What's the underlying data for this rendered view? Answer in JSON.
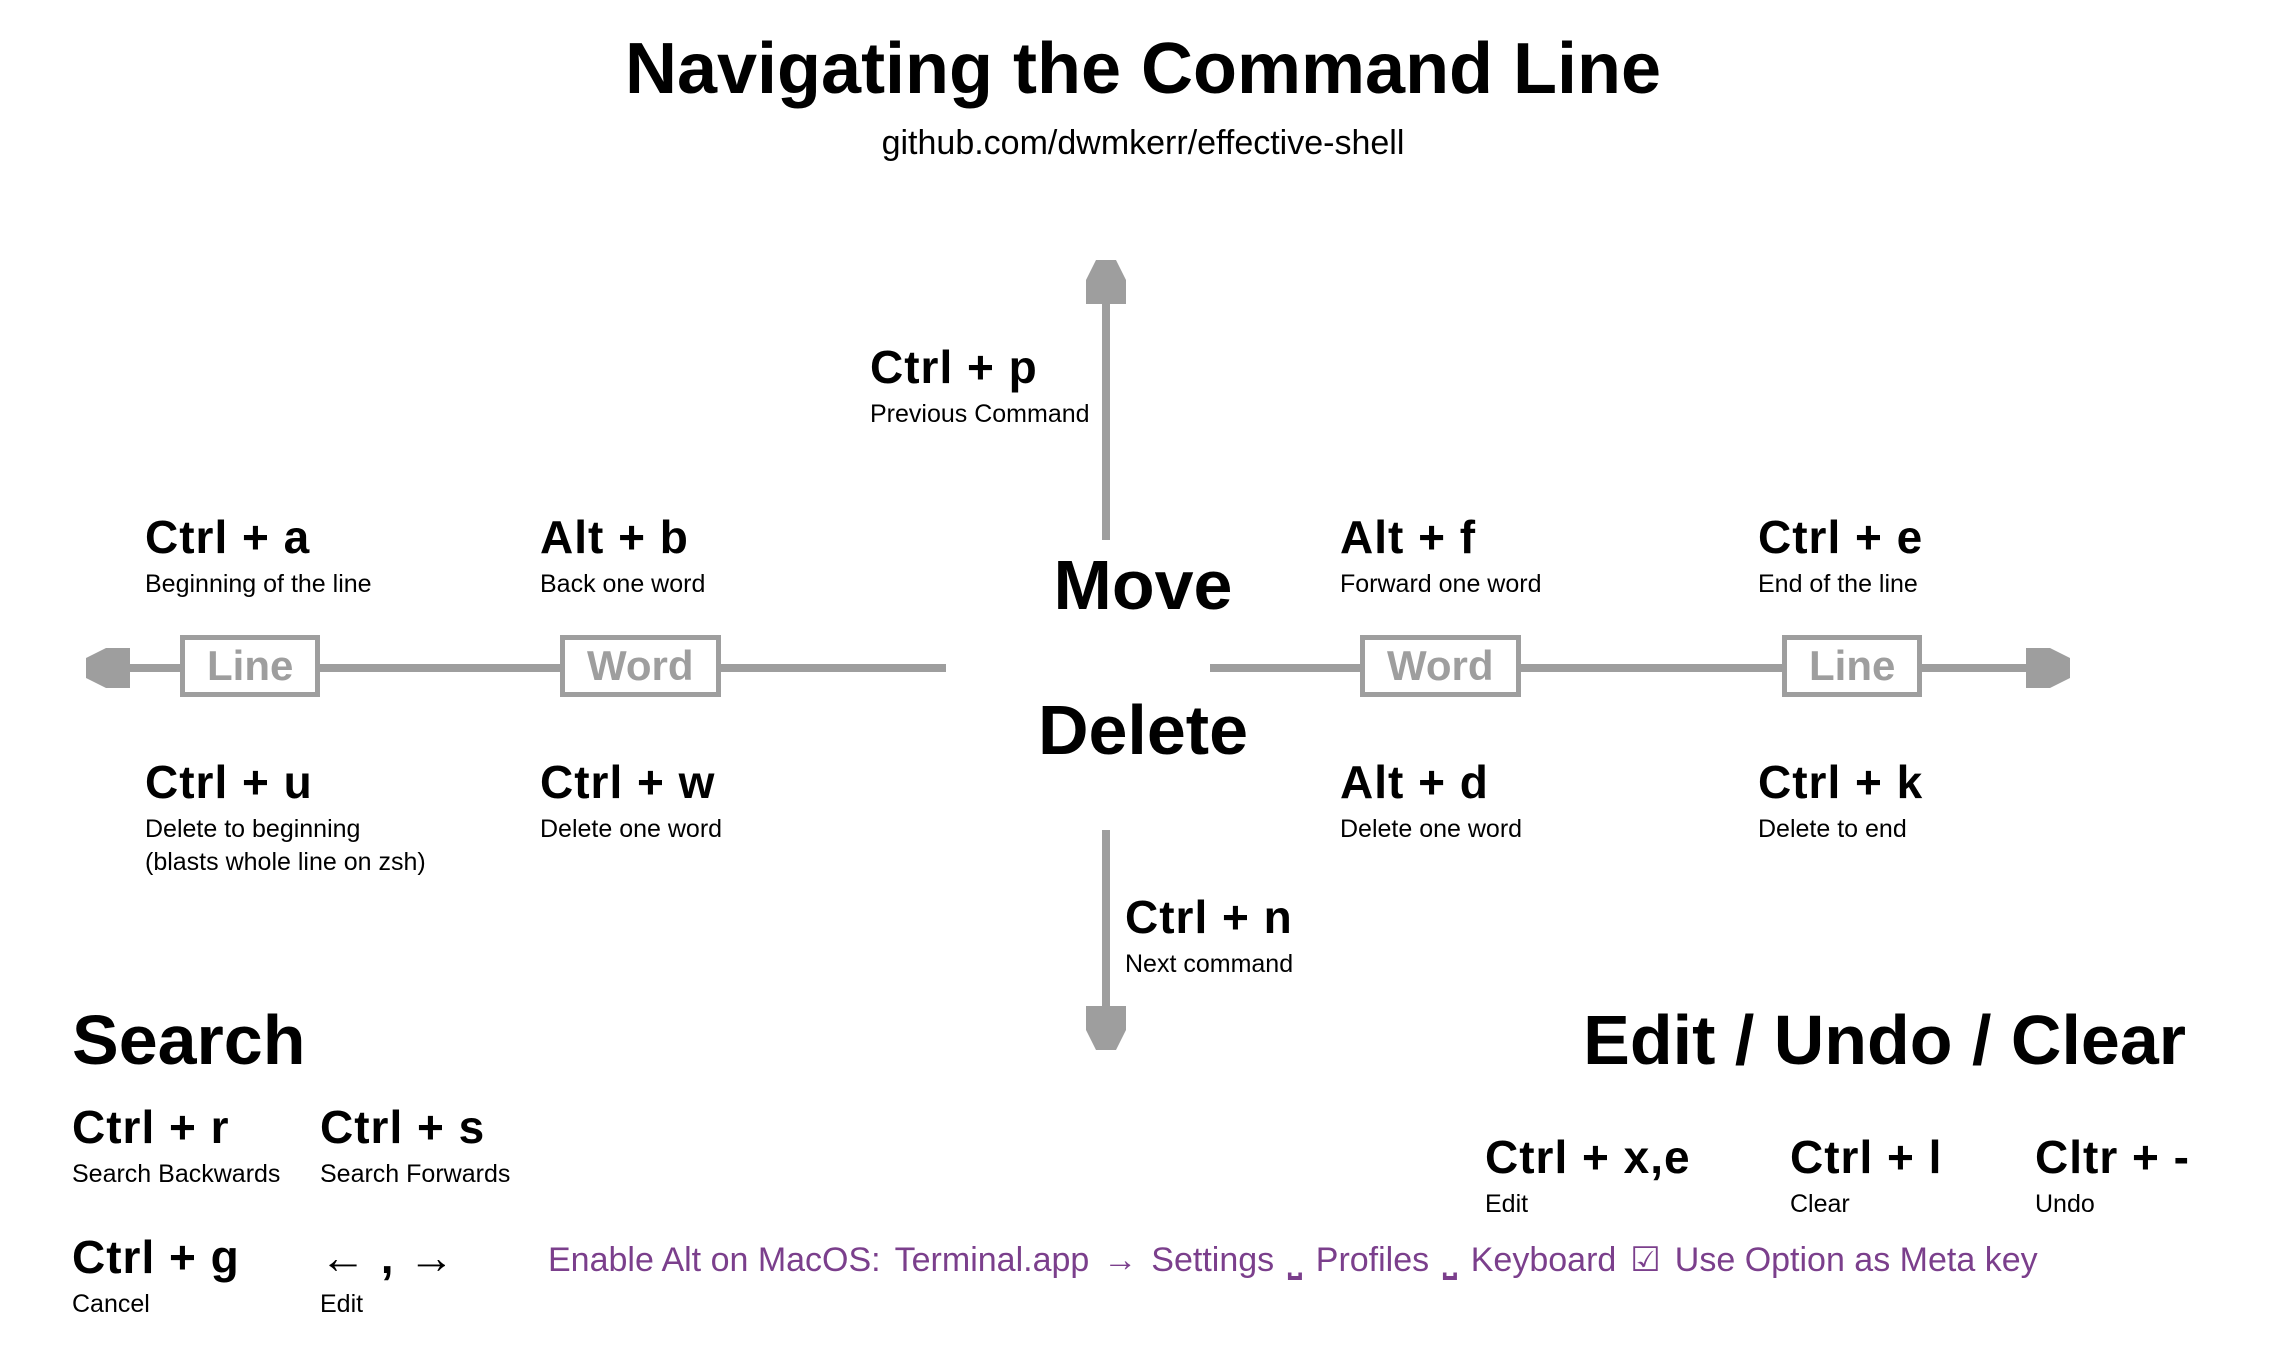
{
  "title": "Navigating the Command Line",
  "subtitle": "github.com/dwmkerr/effective-shell",
  "center": {
    "move": "Move",
    "delete": "Delete"
  },
  "pills": {
    "line": "Line",
    "word": "Word"
  },
  "up": {
    "key": "Ctrl + p",
    "desc": "Previous Command"
  },
  "down": {
    "key": "Ctrl + n",
    "desc": "Next command"
  },
  "left_line": {
    "key": "Ctrl + a",
    "desc": "Beginning of the line"
  },
  "left_word": {
    "key": "Alt + b",
    "desc": "Back one word"
  },
  "right_word": {
    "key": "Alt + f",
    "desc": "Forward one word"
  },
  "right_line": {
    "key": "Ctrl + e",
    "desc": "End of the line"
  },
  "del_left_line": {
    "key": "Ctrl + u",
    "desc": "Delete to beginning",
    "note": "(blasts whole line on zsh)"
  },
  "del_left_word": {
    "key": "Ctrl + w",
    "desc": "Delete one word"
  },
  "del_right_word": {
    "key": "Alt + d",
    "desc": "Delete one word"
  },
  "del_right_line": {
    "key": "Ctrl + k",
    "desc": "Delete to end"
  },
  "search": {
    "heading": "Search",
    "backward": {
      "key": "Ctrl + r",
      "desc": "Search Backwards"
    },
    "forward": {
      "key": "Ctrl + s",
      "desc": "Search Forwards"
    },
    "cancel": {
      "key": "Ctrl + g",
      "desc": "Cancel"
    },
    "edit": {
      "glyphs": "← , →",
      "desc": "Edit"
    }
  },
  "edit": {
    "heading": "Edit / Undo / Clear",
    "edit": {
      "key": "Ctrl + x,e",
      "desc": "Edit"
    },
    "clear": {
      "key": "Ctrl + l",
      "desc": "Clear"
    },
    "undo": {
      "key": "Cltr + -",
      "desc": "Undo"
    }
  },
  "footer": {
    "lead": "Enable Alt on MacOS:",
    "app": "Terminal.app",
    "arrow": "→",
    "settings": "Settings",
    "profiles": "Profiles",
    "keyboard": "Keyboard",
    "meta": "Use Option as Meta key",
    "tab_glyph": "⎵",
    "check_glyph": "☑"
  }
}
